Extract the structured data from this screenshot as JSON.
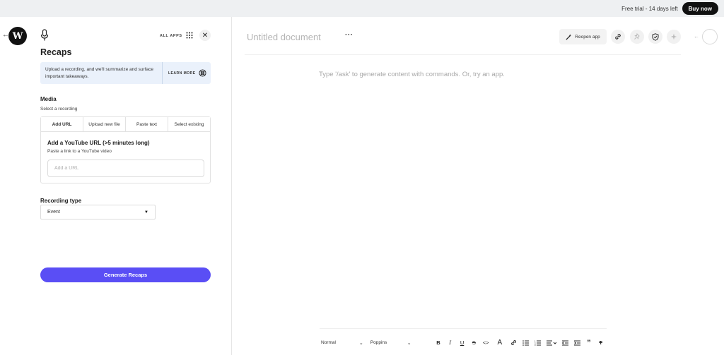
{
  "topbar": {
    "trial_text": "Free trial - 14 days left",
    "buy_label": "Buy now"
  },
  "panel": {
    "logo_letter": "W",
    "all_apps_label": "ALL APPS",
    "title": "Recaps",
    "info_text": "Upload a recording, and we'll summarize and surface important takeaways.",
    "learn_more_label": "LEARN MORE",
    "media_label": "Media",
    "media_sub": "Select a recording",
    "tabs": [
      "Add URL",
      "Upload new file",
      "Paste text",
      "Select existing"
    ],
    "yt_title": "Add a YouTube URL (>5 minutes long)",
    "yt_sub": "Paste a link to a YouTube video",
    "url_placeholder": "Add a URL",
    "recording_type_label": "Recording type",
    "recording_type_value": "Event",
    "generate_label": "Generate Recaps"
  },
  "doc": {
    "title": "Untitled document",
    "more_label": "···",
    "reopen_label": "Reopen app",
    "placeholder": "Type '/ask' to generate content with commands. Or, try an app."
  },
  "toolbar": {
    "style_value": "Normal",
    "font_value": "Poppins",
    "icons": {
      "bold": "B",
      "italic": "I",
      "underline": "U",
      "strike": "S",
      "code": "<>",
      "text_color": "A",
      "link": "🔗",
      "bullets": "☰",
      "numbered": "≡",
      "align": "≡",
      "outdent": "⇤",
      "indent": "⇥",
      "quote": "”",
      "clear": "T"
    }
  },
  "colors": {
    "accent": "#5a4ef5",
    "info_bg": "#eaf1fb",
    "dark": "#111111"
  }
}
